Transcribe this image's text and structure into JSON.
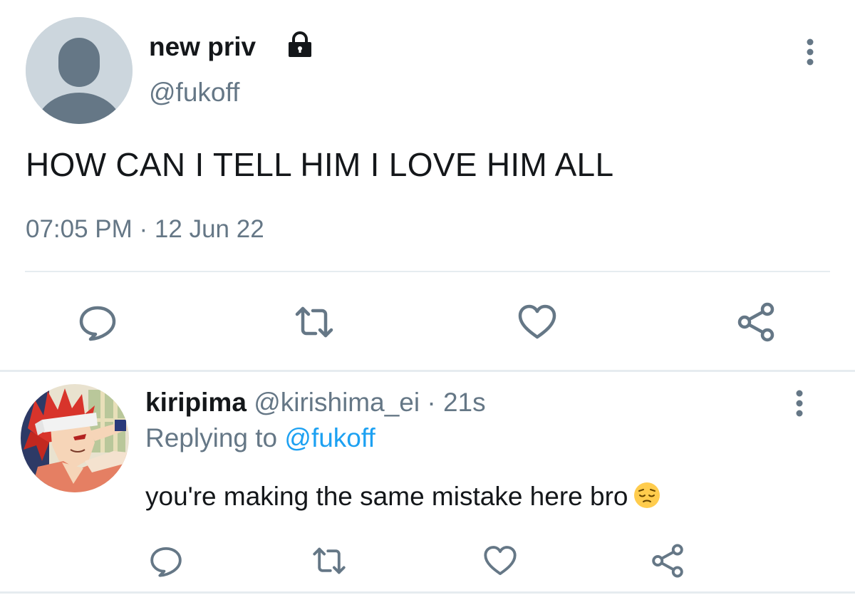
{
  "tweet": {
    "author_name": "new priv",
    "author_handle": "@fukoff",
    "protected_icon": "lock-icon",
    "more_icon": "more-vertical-icon",
    "text": "HOW CAN I TELL HIM I LOVE HIM ALL",
    "timestamp": "07:05 PM · 12 Jun 22",
    "actions": {
      "reply_icon": "comment-bubble-icon",
      "retweet_icon": "retweet-icon",
      "like_icon": "heart-icon",
      "share_icon": "share-icon"
    }
  },
  "reply": {
    "author_name": "kiripima",
    "author_handle": "@kirishima_ei",
    "separator": "·",
    "time": "21s",
    "replying_prefix": "Replying to",
    "replying_to": "@fukoff",
    "text": "you're making the same mistake here bro",
    "emoji": "pensive-face-emoji",
    "more_icon": "more-vertical-icon",
    "actions": {
      "reply_icon": "comment-bubble-icon",
      "retweet_icon": "retweet-icon",
      "like_icon": "heart-icon",
      "share_icon": "share-icon"
    }
  },
  "colors": {
    "text_primary": "#14171a",
    "text_secondary": "#657786",
    "link": "#1da1f2",
    "icon": "#657786",
    "divider": "#e6ecf0",
    "default_avatar_bg": "#ccd6dd",
    "default_avatar_fg": "#657786"
  }
}
